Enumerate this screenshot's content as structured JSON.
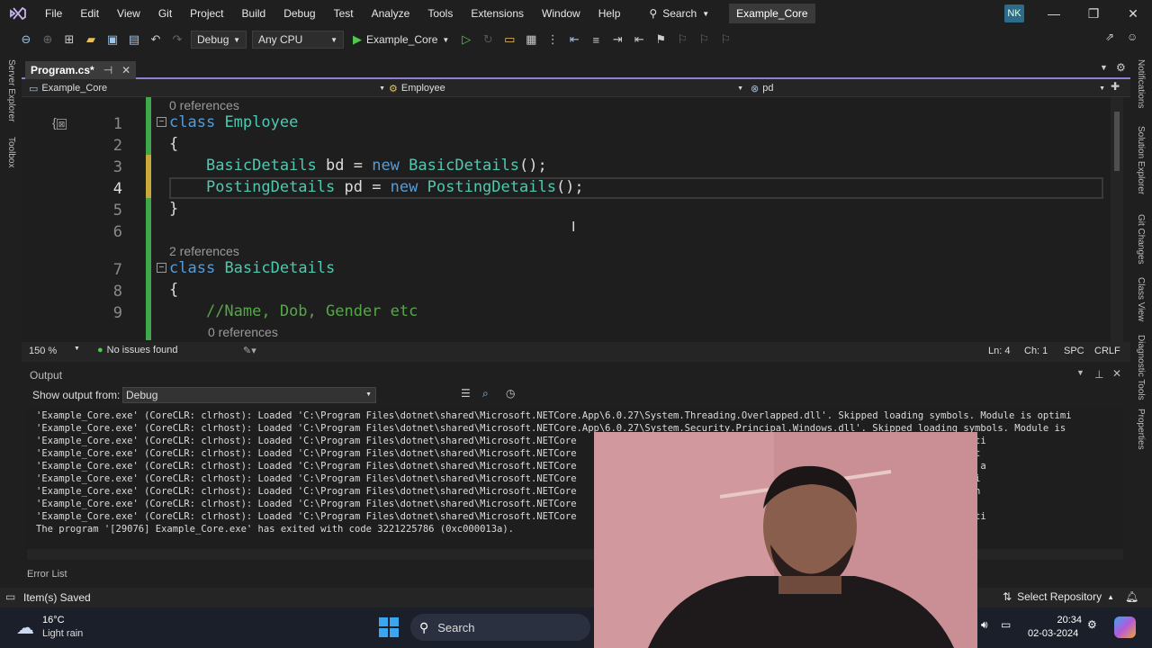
{
  "menubar": {
    "items": [
      "File",
      "Edit",
      "View",
      "Git",
      "Project",
      "Build",
      "Debug",
      "Test",
      "Analyze",
      "Tools",
      "Extensions",
      "Window",
      "Help"
    ],
    "search": "Search",
    "solution": "Example_Core",
    "avatar": "NK"
  },
  "toolbar": {
    "config": "Debug",
    "platform": "Any CPU",
    "run_target": "Example_Core"
  },
  "left_rail": [
    "Server Explorer",
    "Toolbox"
  ],
  "right_rail": [
    "Notifications",
    "Solution Explorer",
    "Git Changes",
    "Class View",
    "Diagnostic Tools",
    "Properties"
  ],
  "tab": {
    "title": "Program.cs*"
  },
  "navbar": {
    "project": "Example_Core",
    "class": "Employee",
    "member": "pd"
  },
  "editor": {
    "line_numbers": [
      "1",
      "2",
      "3",
      "4",
      "5",
      "6",
      "7",
      "8",
      "9"
    ],
    "refs": [
      "0 references",
      "2 references",
      "0 references"
    ],
    "lines": [
      {
        "kw": "class",
        "ty": "Employee"
      },
      {
        "pl": "{"
      },
      {
        "ty": "BasicDetails",
        "pl": " bd = ",
        "kw": "new",
        "ty2": "BasicDetails",
        "pl2": "();"
      },
      {
        "ty": "PostingDetails",
        "pl": " pd = ",
        "kw": "new",
        "ty2": "PostingDetails",
        "pl2": "();"
      },
      {
        "pl": "}"
      },
      {
        "pl": ""
      },
      {
        "kw": "class",
        "ty": "BasicDetails"
      },
      {
        "pl": "{"
      },
      {
        "cm": "//Name, Dob, Gender etc"
      }
    ]
  },
  "editor_status": {
    "zoom": "150 %",
    "issues": "No issues found",
    "ln": "Ln: 4",
    "ch": "Ch: 1",
    "spc": "SPC",
    "eol": "CRLF"
  },
  "output": {
    "title": "Output",
    "show_from_label": "Show output from:",
    "source": "Debug",
    "lines": [
      "'Example_Core.exe' (CoreCLR: clrhost): Loaded 'C:\\Program Files\\dotnet\\shared\\Microsoft.NETCore.App\\6.0.27\\System.Threading.Overlapped.dll'. Skipped loading symbols. Module is optimi",
      "'Example_Core.exe' (CoreCLR: clrhost): Loaded 'C:\\Program Files\\dotnet\\shared\\Microsoft.NETCore.App\\6.0.27\\System.Security.Principal.Windows.dll'. Skipped loading symbols. Module is",
      "'Example_Core.exe' (CoreCLR: clrhost): Loaded 'C:\\Program Files\\dotnet\\shared\\Microsoft.NETCore                                                 symbols. Module is opti",
      "'Example_Core.exe' (CoreCLR: clrhost): Loaded 'C:\\Program Files\\dotnet\\shared\\Microsoft.NETCore                                                 symbols. Module is opt",
      "'Example_Core.exe' (CoreCLR: clrhost): Loaded 'C:\\Program Files\\dotnet\\shared\\Microsoft.NETCore                                                 . Module is optimized a",
      "'Example_Core.exe' (CoreCLR: clrhost): Loaded 'C:\\Program Files\\dotnet\\shared\\Microsoft.NETCore                                                 ools. Module is optimi",
      "'Example_Core.exe' (CoreCLR: clrhost): Loaded 'C:\\Program Files\\dotnet\\shared\\Microsoft.NETCore                                                 Module is optimized an",
      "'Example_Core.exe' (CoreCLR: clrhost): Loaded 'C:\\Program Files\\dotnet\\shared\\Microsoft.NETCore                                                 symbols. Module is op",
      "'Example_Core.exe' (CoreCLR: clrhost): Loaded 'C:\\Program Files\\dotnet\\shared\\Microsoft.NETCore                                                 symbols. Module is opti",
      "The program '[29076] Example_Core.exe' has exited with code 3221225786 (0xc000013a)."
    ]
  },
  "error_list": "Error List",
  "statusbar": {
    "left": "Item(s) Saved",
    "right": "Select Repository"
  },
  "taskbar": {
    "temp": "16°C",
    "weather": "Light rain",
    "search": "Search",
    "time": "20:34",
    "date": "02-03-2024"
  }
}
